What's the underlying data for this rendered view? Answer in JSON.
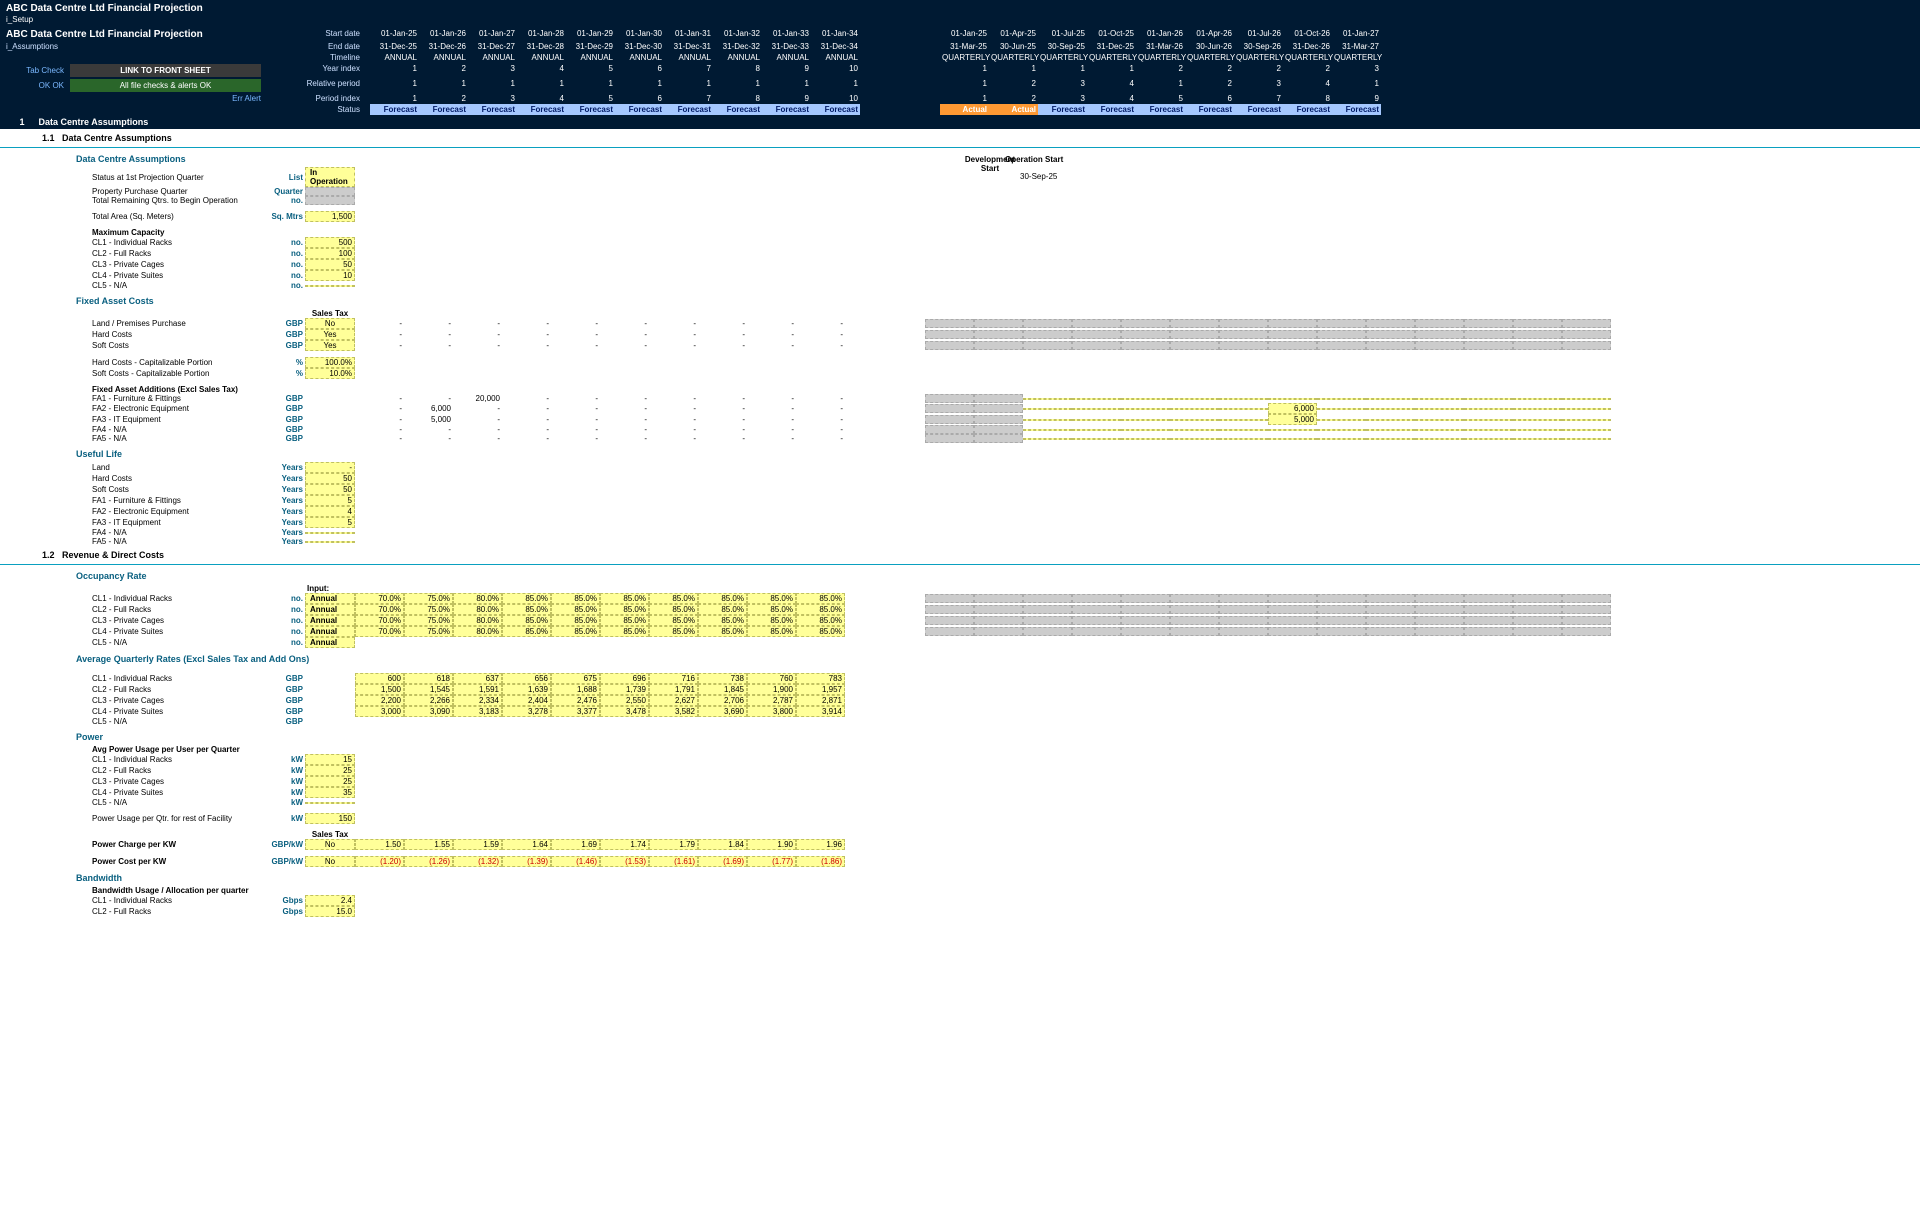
{
  "title_row1": "ABC Data Centre Ltd Financial Projection",
  "subtitle1": "i_Setup",
  "title_row2": "ABC Data Centre Ltd Financial Projection",
  "subtitle2": "i_Assumptions",
  "link_btn": "LINK TO FRONT SHEET",
  "ok_btn": "All file checks & alerts OK",
  "tabcheck_lbl": "Tab Check",
  "tabcheck_ok": "OK  OK",
  "tabcheck_err": "Err  Alert",
  "hdr": {
    "labels": [
      "Start date",
      "End date",
      "Timeline",
      "Year index",
      "Relative period",
      "Period index",
      "Status"
    ],
    "annual_dates_start": [
      "01-Jan-25",
      "01-Jan-26",
      "01-Jan-27",
      "01-Jan-28",
      "01-Jan-29",
      "01-Jan-30",
      "01-Jan-31",
      "01-Jan-32",
      "01-Jan-33",
      "01-Jan-34"
    ],
    "annual_dates_end": [
      "31-Dec-25",
      "31-Dec-26",
      "31-Dec-27",
      "31-Dec-28",
      "31-Dec-29",
      "31-Dec-30",
      "31-Dec-31",
      "31-Dec-32",
      "31-Dec-33",
      "31-Dec-34"
    ],
    "annual": "ANNUAL",
    "year_idx": [
      "1",
      "2",
      "3",
      "4",
      "5",
      "6",
      "7",
      "8",
      "9",
      "10"
    ],
    "rel_period": [
      "1",
      "1",
      "1",
      "1",
      "1",
      "1",
      "1",
      "1",
      "1",
      "1"
    ],
    "period_idx": [
      "1",
      "2",
      "3",
      "4",
      "5",
      "6",
      "7",
      "8",
      "9",
      "10"
    ],
    "q_dates_start": [
      "01-Jan-25",
      "01-Apr-25",
      "01-Jul-25",
      "01-Oct-25",
      "01-Jan-26",
      "01-Apr-26",
      "01-Jul-26",
      "01-Oct-26",
      "01-Jan-27"
    ],
    "q_dates_end": [
      "31-Mar-25",
      "30-Jun-25",
      "30-Sep-25",
      "31-Dec-25",
      "31-Mar-26",
      "30-Jun-26",
      "30-Sep-26",
      "31-Dec-26",
      "31-Mar-27"
    ],
    "quarterly": "QUARTERLY",
    "q_year_idx": [
      "1",
      "1",
      "1",
      "1",
      "2",
      "2",
      "2",
      "2",
      "3"
    ],
    "q_rel": [
      "1",
      "2",
      "3",
      "4",
      "1",
      "2",
      "3",
      "4",
      "1"
    ],
    "q_period": [
      "1",
      "2",
      "3",
      "4",
      "5",
      "6",
      "7",
      "8",
      "9"
    ],
    "forecast": "Forecast",
    "actual": "Actual"
  },
  "sec1": {
    "num": "1",
    "title": "Data Centre Assumptions"
  },
  "sec11": {
    "num": "1.1",
    "title": "Data Centre Assumptions"
  },
  "dev_start": "Development Start",
  "op_start": "Operation Start",
  "op_start_date": "30-Sep-25",
  "g1": {
    "title": "Data Centre Assumptions",
    "rows": [
      {
        "n": "Status at 1st Projection Quarter",
        "u": "List",
        "v": "In Operation",
        "vtype": "yel-l"
      },
      {
        "n": "Property Purchase Quarter",
        "u": "Quarter",
        "v": "",
        "vtype": "grey"
      },
      {
        "n": "Total Remaining Qtrs. to Begin Operation",
        "u": "no.",
        "v": "",
        "vtype": "grey"
      }
    ],
    "area": {
      "n": "Total Area (Sq. Meters)",
      "u": "Sq. Mtrs",
      "v": "1,500"
    },
    "maxcap": "Maximum Capacity",
    "caps": [
      {
        "n": "CL1 - Individual Racks",
        "u": "no.",
        "v": "500"
      },
      {
        "n": "CL2 - Full Racks",
        "u": "no.",
        "v": "100"
      },
      {
        "n": "CL3 - Private Cages",
        "u": "no.",
        "v": "50"
      },
      {
        "n": "CL4 - Private Suites",
        "u": "no.",
        "v": "10"
      },
      {
        "n": "CL5 - N/A",
        "u": "no.",
        "v": ""
      }
    ]
  },
  "g2": {
    "title": "Fixed Asset Costs",
    "salestax": "Sales Tax",
    "costs": [
      {
        "n": "Land / Premises Purchase",
        "u": "GBP",
        "st": "No"
      },
      {
        "n": "Hard Costs",
        "u": "GBP",
        "st": "Yes"
      },
      {
        "n": "Soft Costs",
        "u": "GBP",
        "st": "Yes"
      }
    ],
    "caps": [
      {
        "n": "Hard Costs - Capitalizable Portion",
        "u": "%",
        "v": "100.0%"
      },
      {
        "n": "Soft Costs - Capitalizable Portion",
        "u": "%",
        "v": "10.0%"
      }
    ],
    "faa_title": "Fixed Asset Additions (Excl Sales Tax)",
    "faa": [
      {
        "n": "FA1 - Furniture & Fittings",
        "u": "GBP",
        "ann": [
          "-",
          "-",
          "20,000",
          "-",
          "-",
          "-",
          "-",
          "-",
          "-",
          "-"
        ],
        "qv": [
          "",
          "",
          "",
          "",
          "",
          "",
          "",
          "",
          "",
          "",
          "",
          "",
          "",
          ""
        ]
      },
      {
        "n": "FA2 - Electronic Equipment",
        "u": "GBP",
        "ann": [
          "-",
          "6,000",
          "-",
          "-",
          "-",
          "-",
          "-",
          "-",
          "-",
          "-"
        ],
        "qv": [
          "",
          "",
          "",
          "",
          "",
          "",
          "",
          "6,000",
          "",
          "",
          "",
          "",
          "",
          ""
        ]
      },
      {
        "n": "FA3 - IT Equipment",
        "u": "GBP",
        "ann": [
          "-",
          "5,000",
          "-",
          "-",
          "-",
          "-",
          "-",
          "-",
          "-",
          "-"
        ],
        "qv": [
          "",
          "",
          "",
          "",
          "",
          "",
          "",
          "5,000",
          "",
          "",
          "",
          "",
          "",
          ""
        ]
      },
      {
        "n": "FA4 - N/A",
        "u": "GBP",
        "ann": [
          "-",
          "-",
          "-",
          "-",
          "-",
          "-",
          "-",
          "-",
          "-",
          "-"
        ],
        "qv": [
          "",
          "",
          "",
          "",
          "",
          "",
          "",
          "",
          "",
          "",
          "",
          "",
          "",
          ""
        ]
      },
      {
        "n": "FA5 - N/A",
        "u": "GBP",
        "ann": [
          "-",
          "-",
          "-",
          "-",
          "-",
          "-",
          "-",
          "-",
          "-",
          "-"
        ],
        "qv": [
          "",
          "",
          "",
          "",
          "",
          "",
          "",
          "",
          "",
          "",
          "",
          "",
          "",
          ""
        ]
      }
    ]
  },
  "g3": {
    "title": "Useful Life",
    "rows": [
      {
        "n": "Land",
        "u": "Years",
        "v": "-"
      },
      {
        "n": "Hard Costs",
        "u": "Years",
        "v": "50"
      },
      {
        "n": "Soft Costs",
        "u": "Years",
        "v": "50"
      },
      {
        "n": "FA1 - Furniture & Fittings",
        "u": "Years",
        "v": "5"
      },
      {
        "n": "FA2 - Electronic Equipment",
        "u": "Years",
        "v": "4"
      },
      {
        "n": "FA3 - IT Equipment",
        "u": "Years",
        "v": "5"
      },
      {
        "n": "FA4 - N/A",
        "u": "Years",
        "v": ""
      },
      {
        "n": "FA5 - N/A",
        "u": "Years",
        "v": ""
      }
    ]
  },
  "sec12": {
    "num": "1.2",
    "title": "Revenue & Direct Costs"
  },
  "g4": {
    "title": "Occupancy Rate",
    "input": "Input:",
    "rows": [
      {
        "n": "CL1 - Individual Racks",
        "u": "no.",
        "f": "Annual",
        "v": [
          "70.0%",
          "75.0%",
          "80.0%",
          "85.0%",
          "85.0%",
          "85.0%",
          "85.0%",
          "85.0%",
          "85.0%",
          "85.0%"
        ]
      },
      {
        "n": "CL2 - Full Racks",
        "u": "no.",
        "f": "Annual",
        "v": [
          "70.0%",
          "75.0%",
          "80.0%",
          "85.0%",
          "85.0%",
          "85.0%",
          "85.0%",
          "85.0%",
          "85.0%",
          "85.0%"
        ]
      },
      {
        "n": "CL3 - Private Cages",
        "u": "no.",
        "f": "Annual",
        "v": [
          "70.0%",
          "75.0%",
          "80.0%",
          "85.0%",
          "85.0%",
          "85.0%",
          "85.0%",
          "85.0%",
          "85.0%",
          "85.0%"
        ]
      },
      {
        "n": "CL4 - Private Suites",
        "u": "no.",
        "f": "Annual",
        "v": [
          "70.0%",
          "75.0%",
          "80.0%",
          "85.0%",
          "85.0%",
          "85.0%",
          "85.0%",
          "85.0%",
          "85.0%",
          "85.0%"
        ]
      },
      {
        "n": "CL5 - N/A",
        "u": "no.",
        "f": "Annual",
        "v": [
          "",
          "",
          "",
          "",
          "",
          "",
          "",
          "",
          "",
          ""
        ]
      }
    ]
  },
  "g5": {
    "title": "Average Quarterly Rates (Excl Sales Tax and Add Ons)",
    "rows": [
      {
        "n": "CL1 - Individual Racks",
        "u": "GBP",
        "v": [
          "600",
          "618",
          "637",
          "656",
          "675",
          "696",
          "716",
          "738",
          "760",
          "783"
        ]
      },
      {
        "n": "CL2 - Full Racks",
        "u": "GBP",
        "v": [
          "1,500",
          "1,545",
          "1,591",
          "1,639",
          "1,688",
          "1,739",
          "1,791",
          "1,845",
          "1,900",
          "1,957"
        ]
      },
      {
        "n": "CL3 - Private Cages",
        "u": "GBP",
        "v": [
          "2,200",
          "2,266",
          "2,334",
          "2,404",
          "2,476",
          "2,550",
          "2,627",
          "2,706",
          "2,787",
          "2,871"
        ]
      },
      {
        "n": "CL4 - Private Suites",
        "u": "GBP",
        "v": [
          "3,000",
          "3,090",
          "3,183",
          "3,278",
          "3,377",
          "3,478",
          "3,582",
          "3,690",
          "3,800",
          "3,914"
        ]
      },
      {
        "n": "CL5 - N/A",
        "u": "GBP",
        "v": [
          "",
          "",
          "",
          "",
          "",
          "",
          "",
          "",
          "",
          ""
        ]
      }
    ]
  },
  "g6": {
    "title": "Power",
    "avg_title": "Avg Power Usage per User per Quarter",
    "rows": [
      {
        "n": "CL1 - Individual Racks",
        "u": "kW",
        "v": "15"
      },
      {
        "n": "CL2 - Full Racks",
        "u": "kW",
        "v": "25"
      },
      {
        "n": "CL3 - Private Cages",
        "u": "kW",
        "v": "25"
      },
      {
        "n": "CL4 - Private Suites",
        "u": "kW",
        "v": "35"
      },
      {
        "n": "CL5 - N/A",
        "u": "kW",
        "v": ""
      }
    ],
    "rest": {
      "n": "Power Usage per Qtr. for rest of Facility",
      "u": "kW",
      "v": "150"
    },
    "charge": {
      "n": "Power Charge per KW",
      "u": "GBP/kW",
      "st": "No",
      "v": [
        "1.50",
        "1.55",
        "1.59",
        "1.64",
        "1.69",
        "1.74",
        "1.79",
        "1.84",
        "1.90",
        "1.96"
      ]
    },
    "cost": {
      "n": "Power Cost per KW",
      "u": "GBP/kW",
      "st": "No",
      "v": [
        "(1.20)",
        "(1.26)",
        "(1.32)",
        "(1.39)",
        "(1.46)",
        "(1.53)",
        "(1.61)",
        "(1.69)",
        "(1.77)",
        "(1.86)"
      ]
    }
  },
  "g7": {
    "title": "Bandwidth",
    "sub": "Bandwidth Usage / Allocation per quarter",
    "rows": [
      {
        "n": "CL1 - Individual Racks",
        "u": "Gbps",
        "v": "2.4"
      },
      {
        "n": "CL2 - Full Racks",
        "u": "Gbps",
        "v": "15.0"
      }
    ]
  }
}
